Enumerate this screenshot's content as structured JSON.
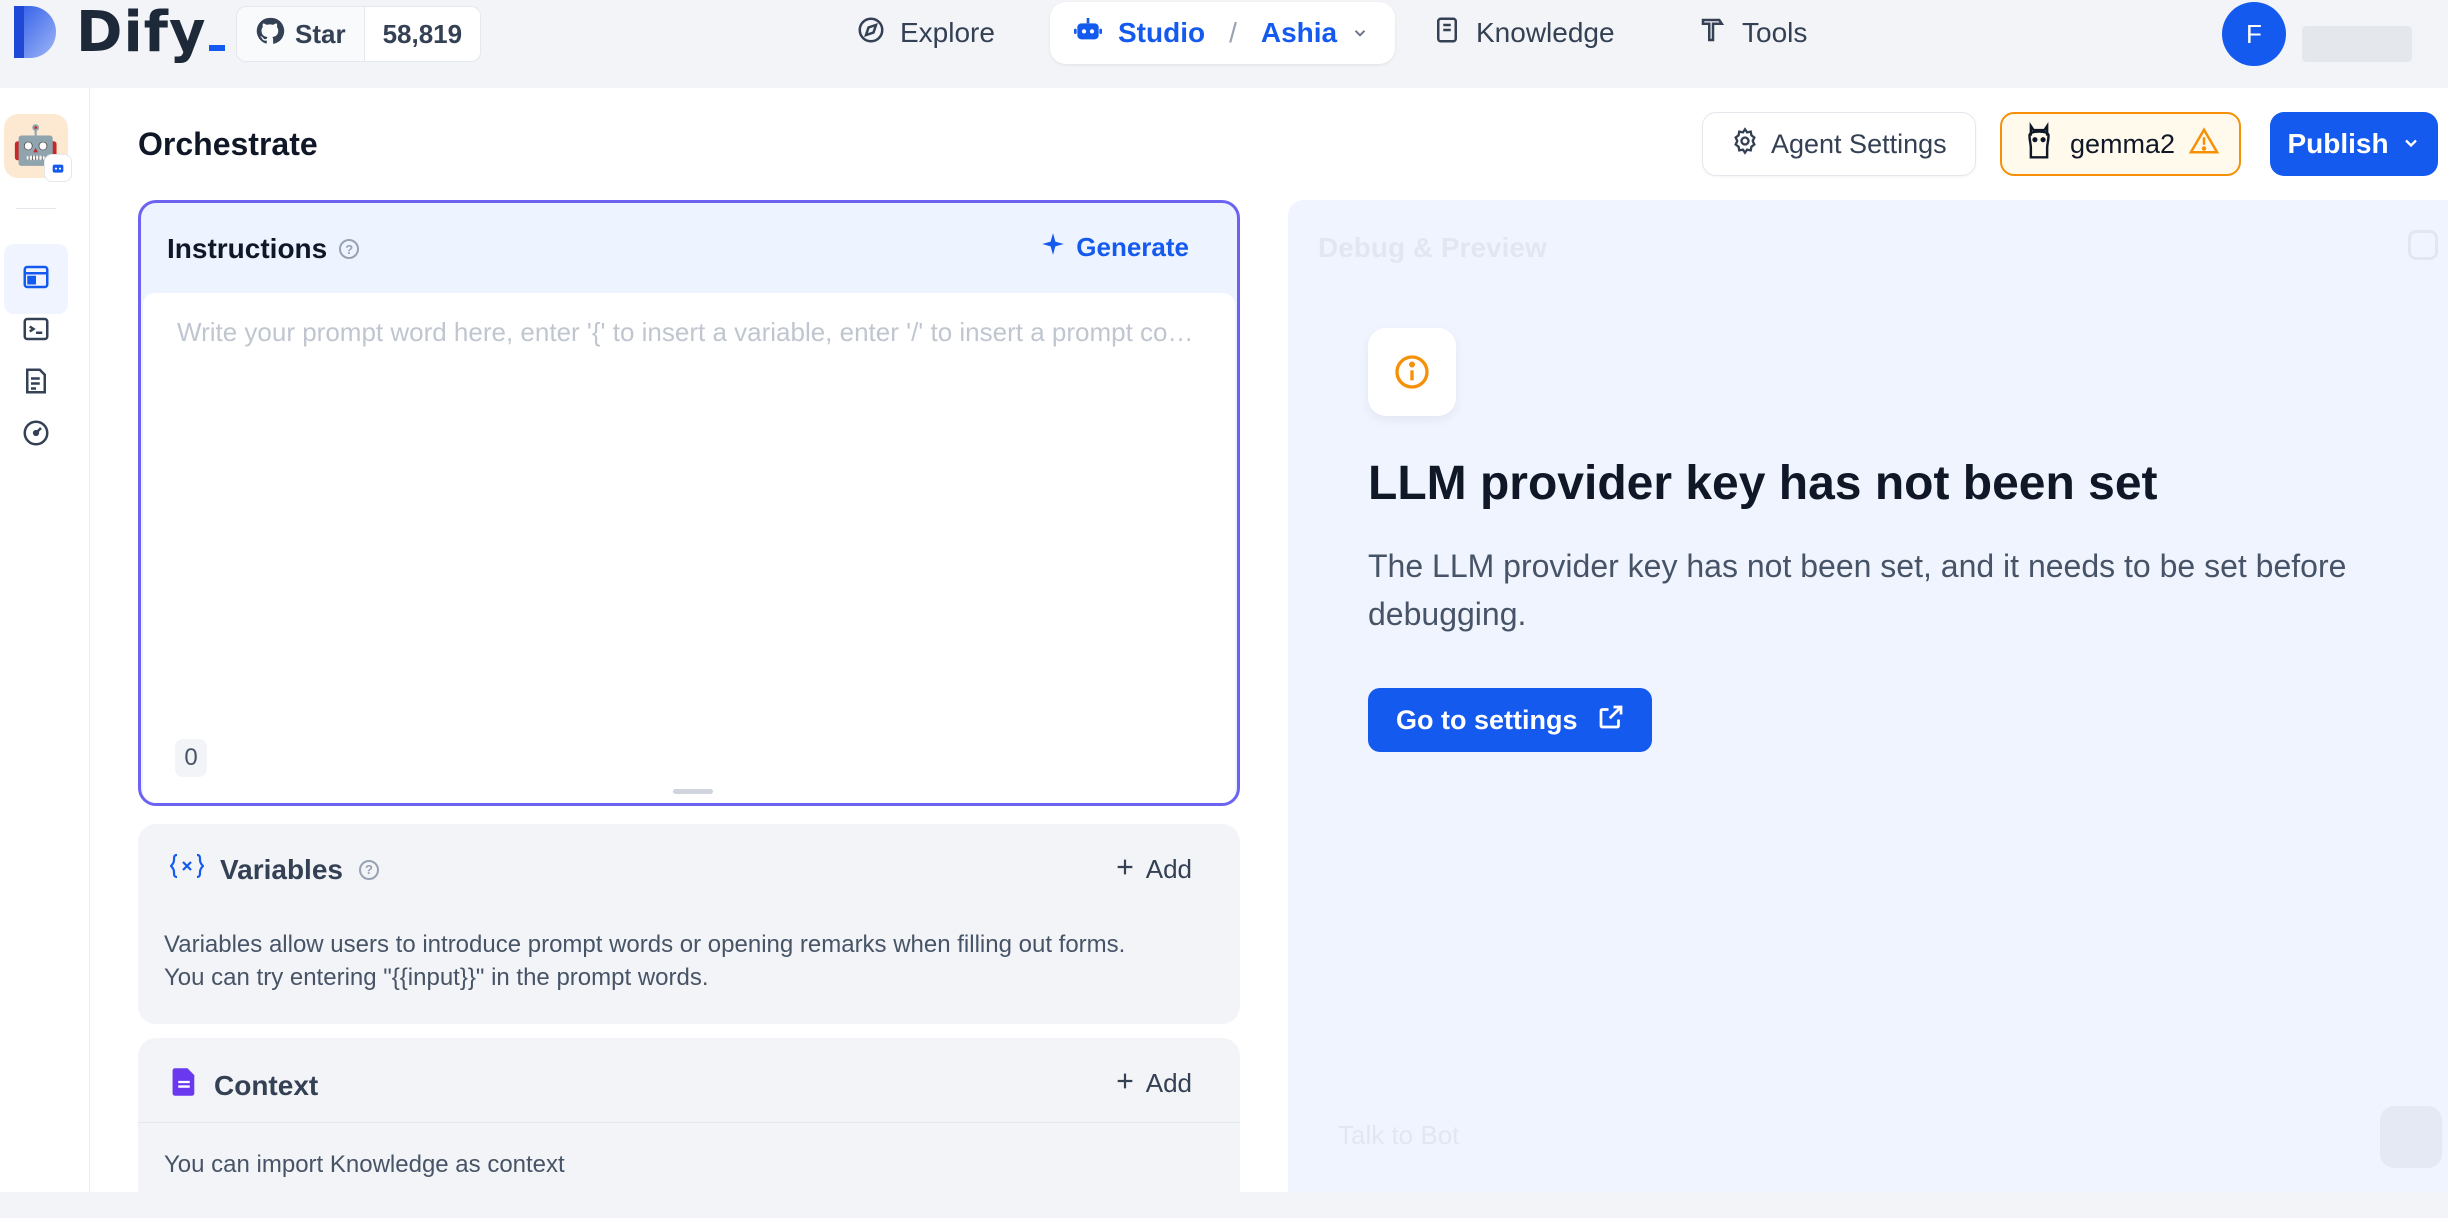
{
  "brand": {
    "name": "Dify"
  },
  "github": {
    "star_label": "Star",
    "star_count": "58,819"
  },
  "nav": {
    "explore": "Explore",
    "studio": "Studio",
    "app": "Ashia",
    "knowledge": "Knowledge",
    "tools": "Tools"
  },
  "user": {
    "initial": "F"
  },
  "header": {
    "title": "Orchestrate",
    "agent_settings": "Agent Settings",
    "model_name": "gemma2",
    "publish": "Publish"
  },
  "instructions": {
    "label": "Instructions",
    "generate": "Generate",
    "placeholder": "Write your prompt word here, enter '{' to insert a variable, enter '/' to insert a prompt content block",
    "char_count": "0"
  },
  "variables": {
    "label": "Variables",
    "add": "Add",
    "desc_line1": "Variables allow users to introduce prompt words or opening remarks when filling out forms.",
    "desc_line2": "You can try entering \"{{input}}\" in the prompt words."
  },
  "context": {
    "label": "Context",
    "add": "Add",
    "desc": "You can import Knowledge as context"
  },
  "debug": {
    "title": "Debug & Preview",
    "warning_title": "LLM provider key has not been set",
    "warning_desc": "The LLM provider key has not been set, and it needs to be set before debugging.",
    "settings_button": "Go to settings",
    "chat_placeholder": "Talk to Bot"
  },
  "colors": {
    "accent": "#155aef",
    "warning": "#f79009",
    "instructions_border": "#6d63f3"
  },
  "icons": {
    "github": "github-icon",
    "explore": "compass-icon",
    "studio": "robot-icon",
    "knowledge": "book-icon",
    "tools": "hammer-icon",
    "agent_settings": "gear-icon",
    "model": "llama-icon",
    "warning": "warning-triangle-icon",
    "generate": "sparkle-icon",
    "variables": "variable-braces-icon",
    "context": "document-icon",
    "external": "external-link-icon"
  }
}
